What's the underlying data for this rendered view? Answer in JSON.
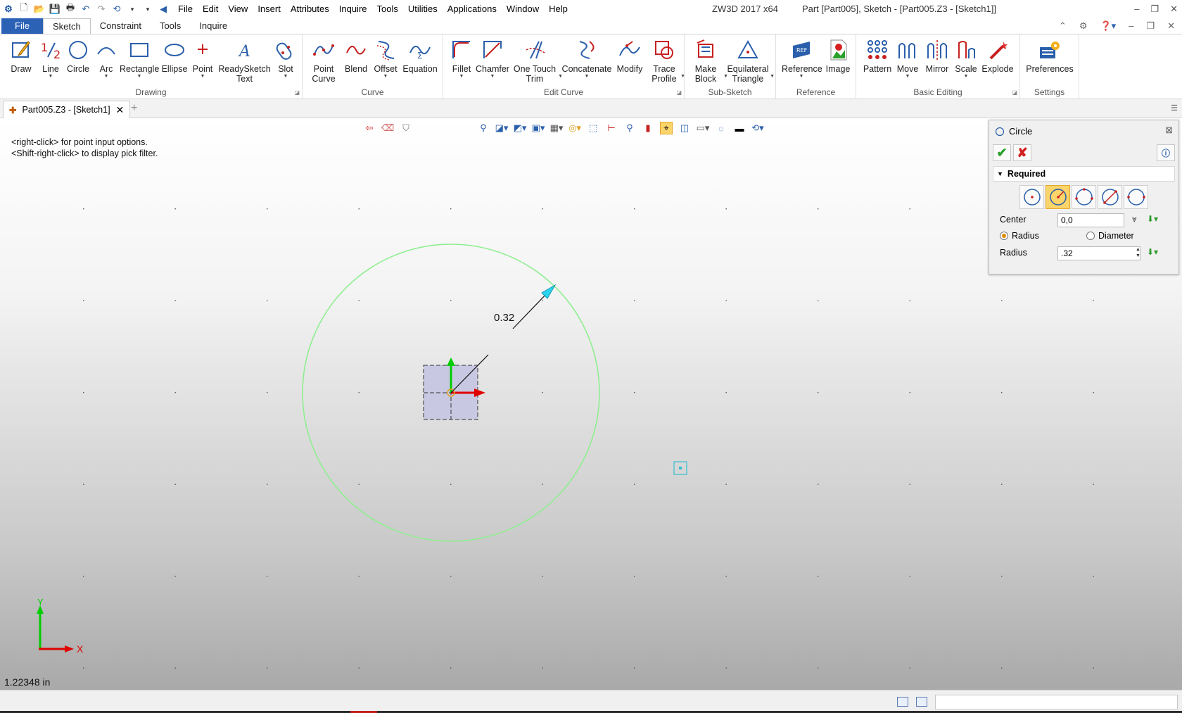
{
  "titlebar": {
    "menu": [
      "File",
      "Edit",
      "View",
      "Insert",
      "Attributes",
      "Inquire",
      "Tools",
      "Utilities",
      "Applications",
      "Window",
      "Help"
    ],
    "app_version": "ZW3D 2017  x64",
    "doc_title": "Part [Part005],  Sketch - [Part005.Z3 - [Sketch1]]"
  },
  "ribbon_tabs": [
    "File",
    "Sketch",
    "Constraint",
    "Tools",
    "Inquire"
  ],
  "ribbon": {
    "drawing": {
      "label": "Drawing",
      "tools": [
        "Draw",
        "Line",
        "Circle",
        "Arc",
        "Rectangle",
        "Ellipse",
        "Point",
        "ReadySketch\nText",
        "Slot"
      ]
    },
    "curve": {
      "label": "Curve",
      "tools": [
        "Point\nCurve",
        "Blend",
        "Offset",
        "Equation"
      ]
    },
    "edit_curve": {
      "label": "Edit Curve",
      "tools": [
        "Fillet",
        "Chamfer",
        "One Touch\nTrim",
        "Concatenate",
        "Modify",
        "Trace\nProfile"
      ]
    },
    "sub_sketch": {
      "label": "Sub-Sketch",
      "tools": [
        "Make\nBlock",
        "Equilateral\nTriangle"
      ]
    },
    "reference": {
      "label": "Reference",
      "tools": [
        "Reference",
        "Image"
      ]
    },
    "basic_editing": {
      "label": "Basic Editing",
      "tools": [
        "Pattern",
        "Move",
        "Mirror",
        "Scale",
        "Explode"
      ]
    },
    "settings": {
      "label": "Settings",
      "tools": [
        "Preferences"
      ]
    }
  },
  "doc_tab": {
    "label": "Part005.Z3 - [Sketch1]"
  },
  "viewport": {
    "hint_1": "<right-click> for point input options.",
    "hint_2": "<Shift-right-click> to display pick filter.",
    "dimension_label": "0.32",
    "axis_x": "X",
    "axis_y": "Y",
    "unit_readout": "1.22348 in",
    "colors": {
      "circle": "#90ee90",
      "arrow": "#2ad4ee",
      "x_axis": "#e00000",
      "y_axis": "#00cc00"
    }
  },
  "panel": {
    "title": "Circle",
    "section": "Required",
    "center_label": "Center",
    "center_value": "0,0",
    "radius_option": "Radius",
    "diameter_option": "Diameter",
    "radius_label": "Radius",
    "radius_value": ".32"
  }
}
